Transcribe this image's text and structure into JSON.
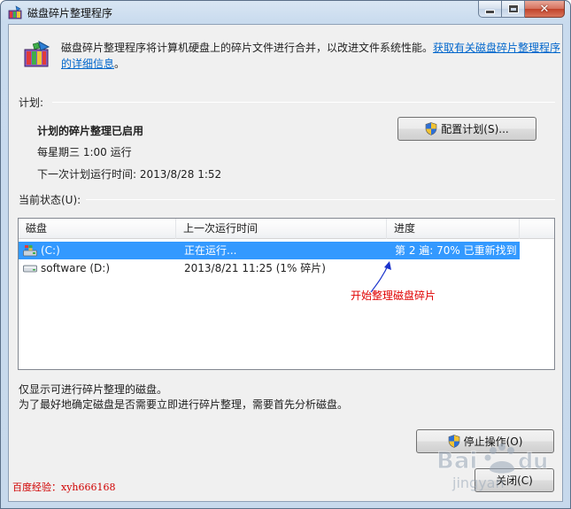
{
  "window": {
    "title": "磁盘碎片整理程序"
  },
  "intro": {
    "text": "磁盘碎片整理程序将计算机硬盘上的碎片文件进行合并，以改进文件系统性能。",
    "link": "获取有关磁盘碎片整理程序的详细信息",
    "end": "。"
  },
  "schedule": {
    "section_label": "计划:",
    "status": "计划的碎片整理已启用",
    "frequency": "每星期三  1:00 运行",
    "next_run": "下一次计划运行时间: 2013/8/28 1:52",
    "configure_button": "配置计划(S)..."
  },
  "current_status": {
    "section_label": "当前状态(U):",
    "columns": [
      "磁盘",
      "上一次运行时间",
      "进度"
    ],
    "rows": [
      {
        "disk": "(C:)",
        "last_run": "正在运行...",
        "progress": "第 2 遍: 70% 已重新找到",
        "selected": true
      },
      {
        "disk": "software (D:)",
        "last_run": "2013/8/21 11:25 (1% 碎片)",
        "progress": "",
        "selected": false
      }
    ]
  },
  "annotation": {
    "text": "开始整理磁盘碎片"
  },
  "notes": {
    "line1": "仅显示可进行碎片整理的磁盘。",
    "line2": "为了最好地确定磁盘是否需要立即进行碎片整理，需要首先分析磁盘。"
  },
  "buttons": {
    "stop": "停止操作(O)",
    "close": "关闭(C)"
  },
  "watermark": {
    "left": "百度经验：xyh666168",
    "right": "Bai du 经验"
  },
  "colors": {
    "selection": "#3399ff",
    "link": "#0066cc",
    "annotation": "#e00000"
  },
  "icons": {
    "title": "defrag-icon",
    "intro": "defrag-icon",
    "uac": "shield-icon",
    "drive_c": "windows-drive-icon",
    "drive_d": "hard-drive-icon"
  }
}
